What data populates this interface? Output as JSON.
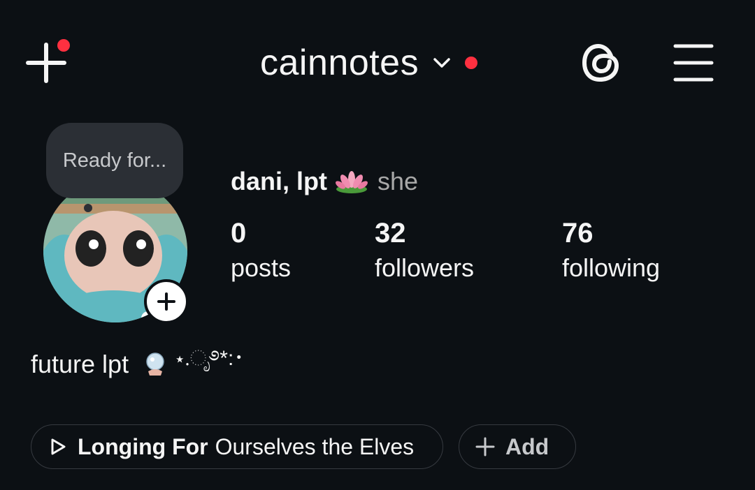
{
  "header": {
    "username": "cainnotes"
  },
  "profile": {
    "note_bubble": "Ready for...",
    "display_name": "dani, lpt",
    "pronouns": "she",
    "stats": [
      {
        "value": "0",
        "label": "posts"
      },
      {
        "value": "32",
        "label": "followers"
      },
      {
        "value": "76",
        "label": "following"
      }
    ],
    "bio": "future lpt",
    "bio_decoration": "⋆.ೃ࿔*:･"
  },
  "music": {
    "artist": "Longing For",
    "song": "Ourselves the Elves"
  },
  "add_button": {
    "label": "Add"
  },
  "colors": {
    "background": "#0c1014",
    "notification_dot": "#ff3040",
    "pill_border": "#363a40"
  },
  "icons": [
    "plus-icon",
    "chevron-down-icon",
    "threads-icon",
    "menu-icon",
    "play-icon"
  ]
}
